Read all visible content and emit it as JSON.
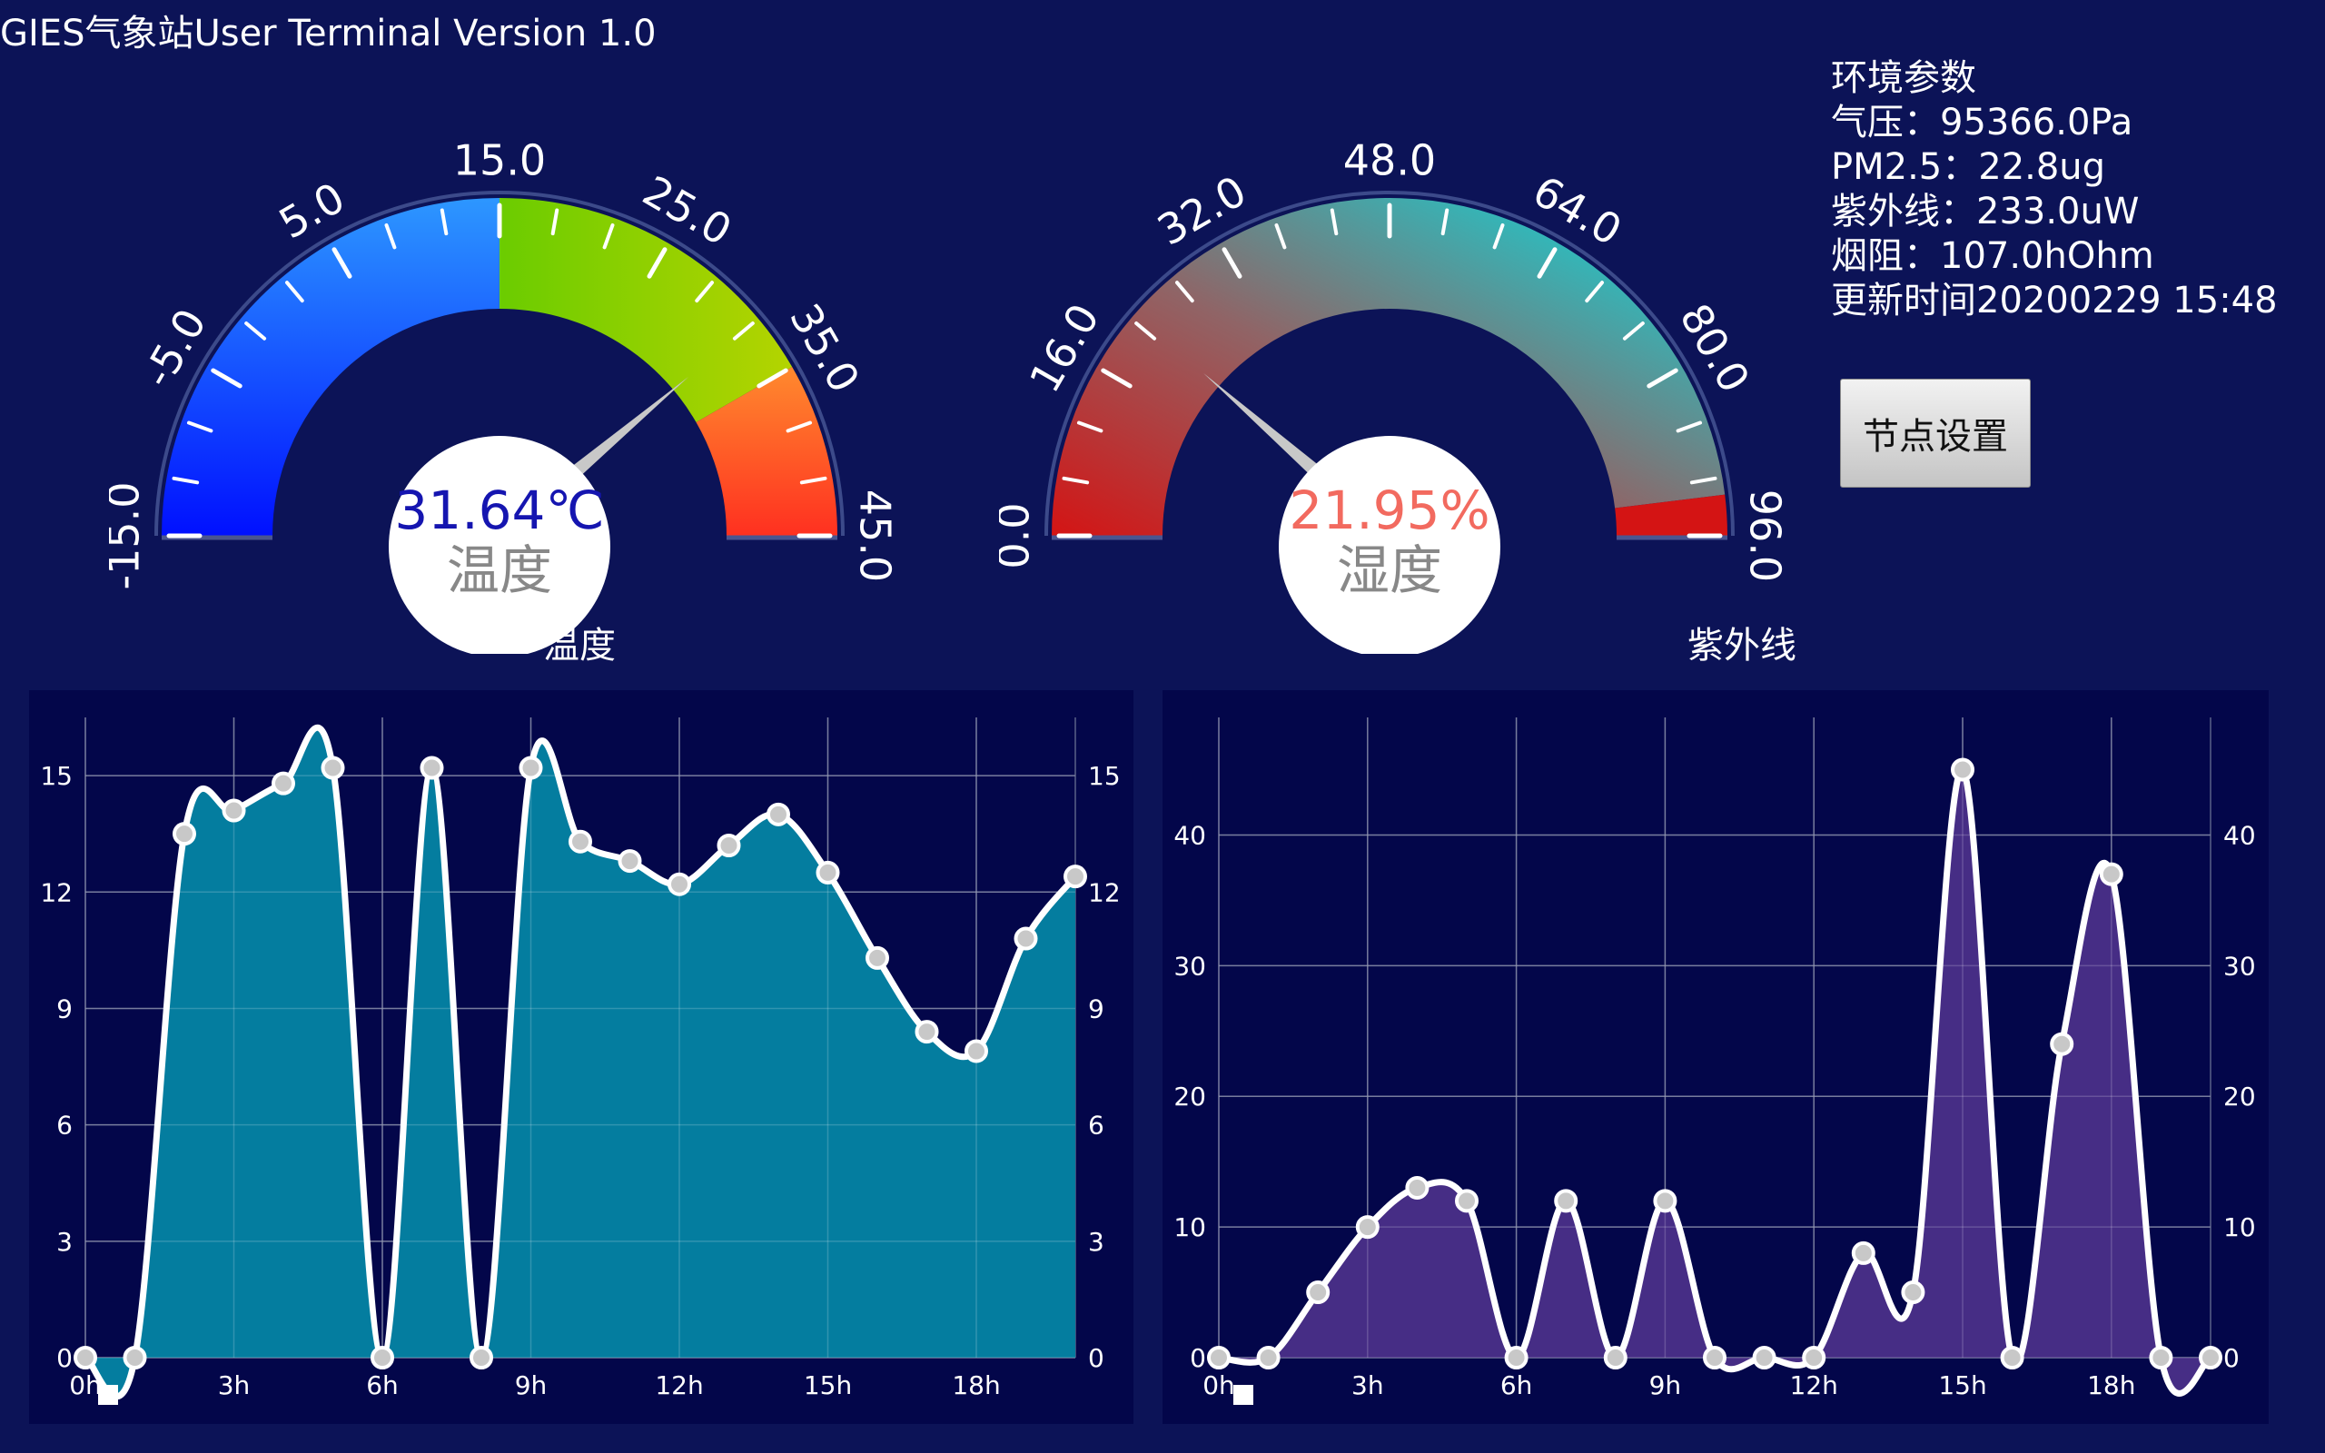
{
  "app": {
    "title": "GIES气象站User Terminal Version 1.0"
  },
  "colors": {
    "background": "#0c1357",
    "chart_panel": "#03064a",
    "temp_fill": "#047d9f",
    "uv_fill": "#462d85",
    "value_blue": "#1515b0",
    "value_salmon": "#f26a5f"
  },
  "gauge_temp": {
    "min": -15,
    "max": 45,
    "value": 31.64,
    "ticks": [
      "-15.0",
      "-5.0",
      "5.0",
      "15.0",
      "25.0",
      "35.0",
      "45.0"
    ],
    "value_text": "31.64℃",
    "label": "温度",
    "caption": "温度"
  },
  "gauge_hum": {
    "min": 0,
    "max": 96,
    "value": 21.95,
    "ticks": [
      "0.0",
      "16.0",
      "32.0",
      "48.0",
      "64.0",
      "80.0",
      "96.0"
    ],
    "value_text": "21.95%",
    "label": "湿度",
    "caption": "紫外线"
  },
  "env": {
    "heading": "环境参数",
    "pressure": "气压：95366.0Pa",
    "pm25": "PM2.5：22.8ug",
    "uv": "紫外线：233.0uW",
    "smoke": "烟阻：107.0hOhm",
    "updated": "更新时间20200229 15:48"
  },
  "node_button": {
    "label": "节点设置"
  },
  "chart_data": [
    {
      "type": "area",
      "x": [
        0,
        1,
        2,
        3,
        4,
        5,
        6,
        7,
        8,
        9,
        10,
        11,
        12,
        13,
        14,
        15,
        16,
        17,
        18,
        19,
        20
      ],
      "x_tick_labels": [
        "0h",
        "3h",
        "6h",
        "9h",
        "12h",
        "15h",
        "18h"
      ],
      "values": [
        0,
        0,
        13.5,
        14.1,
        14.8,
        15.2,
        0,
        15.2,
        0,
        15.2,
        13.3,
        12.8,
        12.2,
        13.2,
        14.0,
        12.5,
        10.3,
        8.4,
        7.9,
        10.8,
        12.4
      ],
      "y_ticks": [
        "0",
        "3",
        "6",
        "9",
        "12",
        "15"
      ],
      "xlim": [
        0,
        20
      ],
      "ylim": [
        0,
        16.5
      ],
      "grid": true
    },
    {
      "type": "area",
      "x": [
        0,
        1,
        2,
        3,
        4,
        5,
        6,
        7,
        8,
        9,
        10,
        11,
        12,
        13,
        14,
        15,
        16,
        17,
        18,
        19,
        20
      ],
      "x_tick_labels": [
        "0h",
        "3h",
        "6h",
        "9h",
        "12h",
        "15h",
        "18h"
      ],
      "values": [
        0,
        0,
        5,
        10,
        13,
        12,
        0,
        12,
        0,
        12,
        0,
        0,
        0,
        8,
        5,
        45,
        0,
        24,
        37,
        0,
        0
      ],
      "y_ticks": [
        "0",
        "10",
        "20",
        "30",
        "40"
      ],
      "xlim": [
        0,
        20
      ],
      "ylim": [
        0,
        49
      ],
      "grid": true
    }
  ]
}
